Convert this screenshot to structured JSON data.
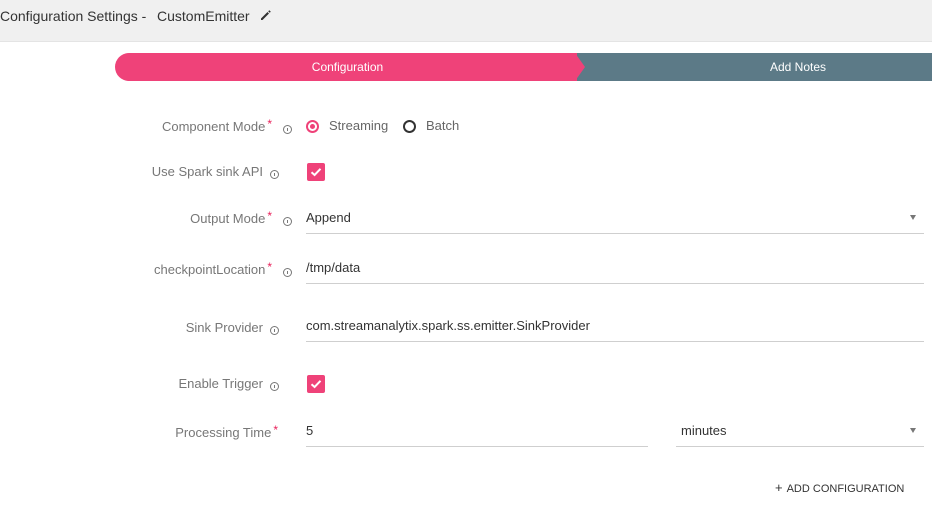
{
  "header": {
    "title": "Configuration Settings -",
    "component_name": "CustomEmitter"
  },
  "stepper": {
    "steps": [
      {
        "label": "Configuration",
        "active": true
      },
      {
        "label": "Add Notes",
        "active": false
      }
    ]
  },
  "form": {
    "component_mode": {
      "label": "Component Mode",
      "required": "*",
      "options": [
        "Streaming",
        "Batch"
      ],
      "selected": "Streaming"
    },
    "use_spark_sink_api": {
      "label": "Use Spark sink API",
      "checked": true
    },
    "output_mode": {
      "label": "Output Mode",
      "required": "*",
      "value": "Append"
    },
    "checkpoint_location": {
      "label": "checkpointLocation",
      "required": "*",
      "value": "/tmp/data"
    },
    "sink_provider": {
      "label": "Sink Provider",
      "value": "com.streamanalytix.spark.ss.emitter.SinkProvider"
    },
    "enable_trigger": {
      "label": "Enable Trigger",
      "checked": true
    },
    "processing_time": {
      "label": "Processing Time",
      "required": "*",
      "value": "5",
      "unit": "minutes"
    }
  },
  "actions": {
    "add_configuration_plus": "+",
    "add_configuration": "ADD CONFIGURATION"
  },
  "colors": {
    "accent": "#ef4279",
    "step_inactive": "#5c7a87",
    "header_bg": "#f0f0f0"
  }
}
